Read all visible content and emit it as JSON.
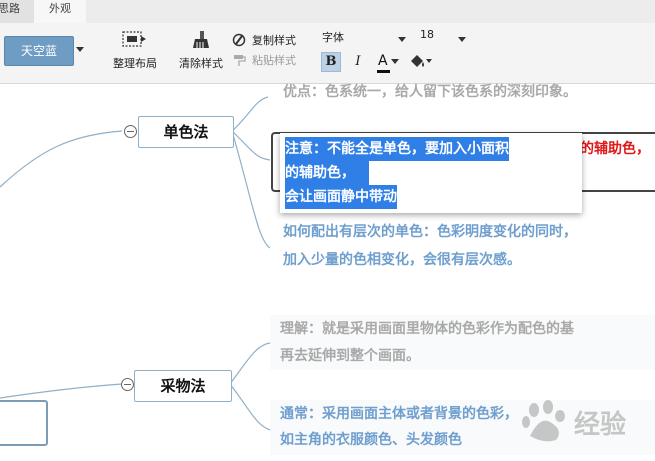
{
  "tabs": {
    "active": "思路",
    "appearance": "外观"
  },
  "toolbar": {
    "theme": {
      "label": "天空蓝",
      "color": "#6f9cc3"
    },
    "arrange": {
      "label": "整理布局",
      "icon": "arrange-layout-icon"
    },
    "clear_style": {
      "label": "清除样式",
      "icon": "broom-icon"
    },
    "copy_style": {
      "label": "复制样式",
      "icon": "paint-brush-icon"
    },
    "paste_style": {
      "label": "粘贴样式",
      "icon": "paint-roller-icon"
    },
    "font": {
      "value": "字体"
    },
    "font_size": {
      "value": "18"
    },
    "bold": "B",
    "italic": "I",
    "font_color": {
      "label": "A",
      "bar_color": "#111111"
    },
    "fill_color": {
      "icon": "paint-bucket-icon"
    }
  },
  "map": {
    "topic1": "单色法",
    "topic2": "采物法",
    "note_advantage": "优点：色系统一，给人留下该色系的深刻印象。",
    "note_warning": {
      "line1": "注意：不能全是单色，要加入小面积",
      "line1_tail": "的辅助色，",
      "line2": "的辅助色，",
      "line3": "会让画面静中带动",
      "highlight_color": "#2f7fe6",
      "tail_color": "#e01818"
    },
    "note_layer": {
      "line1": "如何配出有层次的单色：色彩明度变化的同时，",
      "line2": "加入少量的色相变化，会很有层次感。"
    },
    "note_understand": {
      "line1": "理解：就是采用画面里物体的色彩作为配色的基",
      "line2": "再去延伸到整个画面。"
    },
    "note_common": {
      "line1": "通常：采用画面主体或者背景的色彩，",
      "line2": "如主角的衣服颜色、头发颜色"
    }
  },
  "colors": {
    "line": "#8fb0c9",
    "note_gray": "#a9a9a9",
    "note_blue": "#6f9fce",
    "selection": "#2f7fe6"
  },
  "watermark": {
    "text": "经验",
    "icon": "baidu-watermark-icon"
  }
}
